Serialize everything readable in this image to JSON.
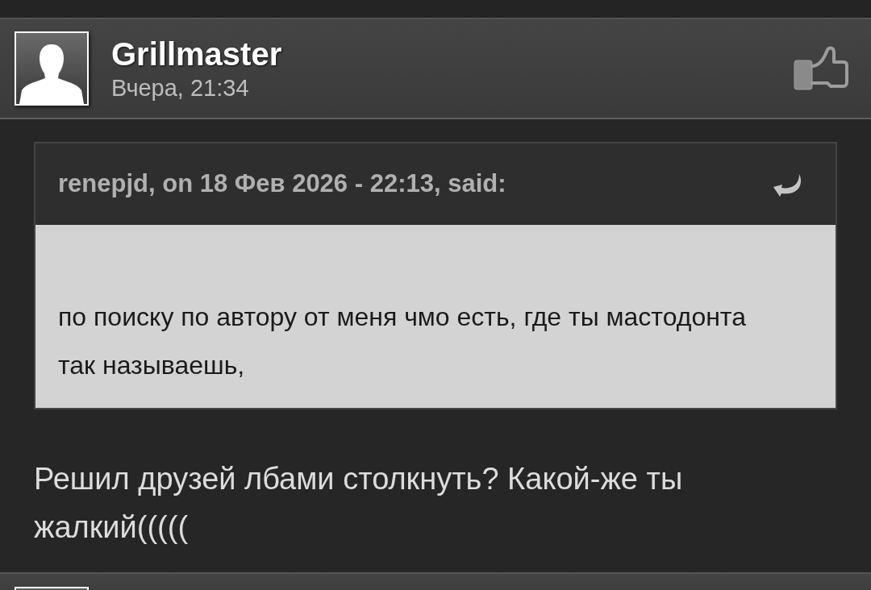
{
  "post": {
    "author": "Grillmaster",
    "time": "Вчера, 21:34",
    "quote": {
      "citation": "renepjd, on 18 Фев 2026 - 22:13, said:",
      "text": "по поиску по автору от меня чмо есть, где ты мастодонта так называешь,"
    },
    "text": "Решил друзей лбами столкнуть? Какой-же ты жалкий((((("
  }
}
